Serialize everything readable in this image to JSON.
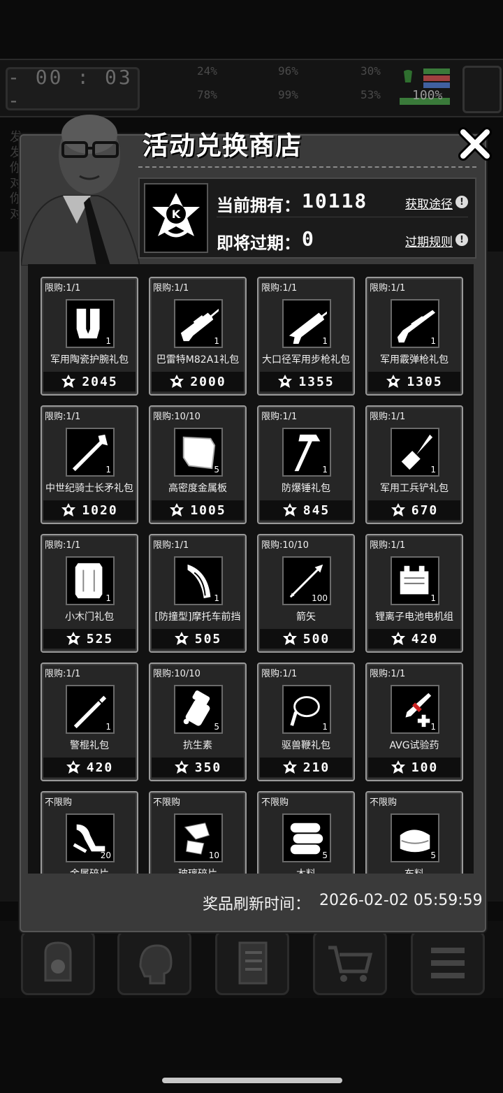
{
  "hud": {
    "timer": "- 00 : 03 -",
    "stats": [
      "24%",
      "96%",
      "30%",
      "78%",
      "99%",
      "53%"
    ],
    "battery": "100%"
  },
  "bg_text": [
    "发",
    "发",
    "你",
    "对",
    "你",
    "对"
  ],
  "shop": {
    "title": "活动兑换商店",
    "owned_label": "当前拥有：",
    "owned_value": "10118",
    "expire_label": "即将过期：",
    "expire_value": "0",
    "obtain_link": "获取途径",
    "expire_rules_link": "过期规则",
    "refresh_label": "奖品刷新时间：",
    "refresh_value": "2026-02-02 05:59:59"
  },
  "items": [
    {
      "limit": "限购:1/1",
      "name": "军用陶瓷护腕礼包",
      "qty": "1",
      "price": "2045",
      "icon": "bracer-icon"
    },
    {
      "limit": "限购:1/1",
      "name": "巴雷特M82A1礼包",
      "qty": "1",
      "price": "2000",
      "icon": "sniper-rifle-icon"
    },
    {
      "limit": "限购:1/1",
      "name": "大口径军用步枪礼包",
      "qty": "1",
      "price": "1355",
      "icon": "assault-rifle-icon"
    },
    {
      "limit": "限购:1/1",
      "name": "军用霰弹枪礼包",
      "qty": "1",
      "price": "1305",
      "icon": "shotgun-icon"
    },
    {
      "limit": "限购:1/1",
      "name": "中世纪骑士长矛礼包",
      "qty": "1",
      "price": "1020",
      "icon": "spear-icon"
    },
    {
      "limit": "限购:10/10",
      "name": "高密度金属板",
      "qty": "5",
      "price": "1005",
      "icon": "metal-plate-icon"
    },
    {
      "limit": "限购:1/1",
      "name": "防爆锤礼包",
      "qty": "1",
      "price": "845",
      "icon": "hammer-icon"
    },
    {
      "limit": "限购:1/1",
      "name": "军用工兵铲礼包",
      "qty": "1",
      "price": "670",
      "icon": "shovel-icon"
    },
    {
      "limit": "限购:1/1",
      "name": "小木门礼包",
      "qty": "1",
      "price": "525",
      "icon": "wooden-door-icon"
    },
    {
      "limit": "限购:1/1",
      "name": "[防撞型]摩托车前挡",
      "qty": "1",
      "price": "505",
      "icon": "windshield-icon"
    },
    {
      "limit": "限购:10/10",
      "name": "箭矢",
      "qty": "100",
      "price": "500",
      "icon": "arrow-icon"
    },
    {
      "limit": "限购:1/1",
      "name": "锂离子电池电机组",
      "qty": "1",
      "price": "420",
      "icon": "battery-icon"
    },
    {
      "limit": "限购:1/1",
      "name": "警棍礼包",
      "qty": "1",
      "price": "420",
      "icon": "baton-icon"
    },
    {
      "limit": "限购:10/10",
      "name": "抗生素",
      "qty": "5",
      "price": "350",
      "icon": "pill-bottle-icon"
    },
    {
      "limit": "限购:1/1",
      "name": "驱兽鞭礼包",
      "qty": "1",
      "price": "210",
      "icon": "whip-icon"
    },
    {
      "limit": "限购:1/1",
      "name": "AVG试验药",
      "qty": "1",
      "price": "100",
      "icon": "syringe-icon"
    },
    {
      "limit": "不限购",
      "name": "金属碎片",
      "qty": "20",
      "price": "",
      "icon": "metal-scrap-icon"
    },
    {
      "limit": "不限购",
      "name": "玻璃碎片",
      "qty": "10",
      "price": "",
      "icon": "glass-shard-icon"
    },
    {
      "limit": "不限购",
      "name": "木料",
      "qty": "5",
      "price": "",
      "icon": "wood-logs-icon"
    },
    {
      "limit": "不限购",
      "name": "布料",
      "qty": "5",
      "price": "",
      "icon": "cloth-icon"
    }
  ],
  "nav": [
    "backpack-icon",
    "brain-icon",
    "notebook-icon",
    "cart-icon",
    "menu-icon"
  ]
}
